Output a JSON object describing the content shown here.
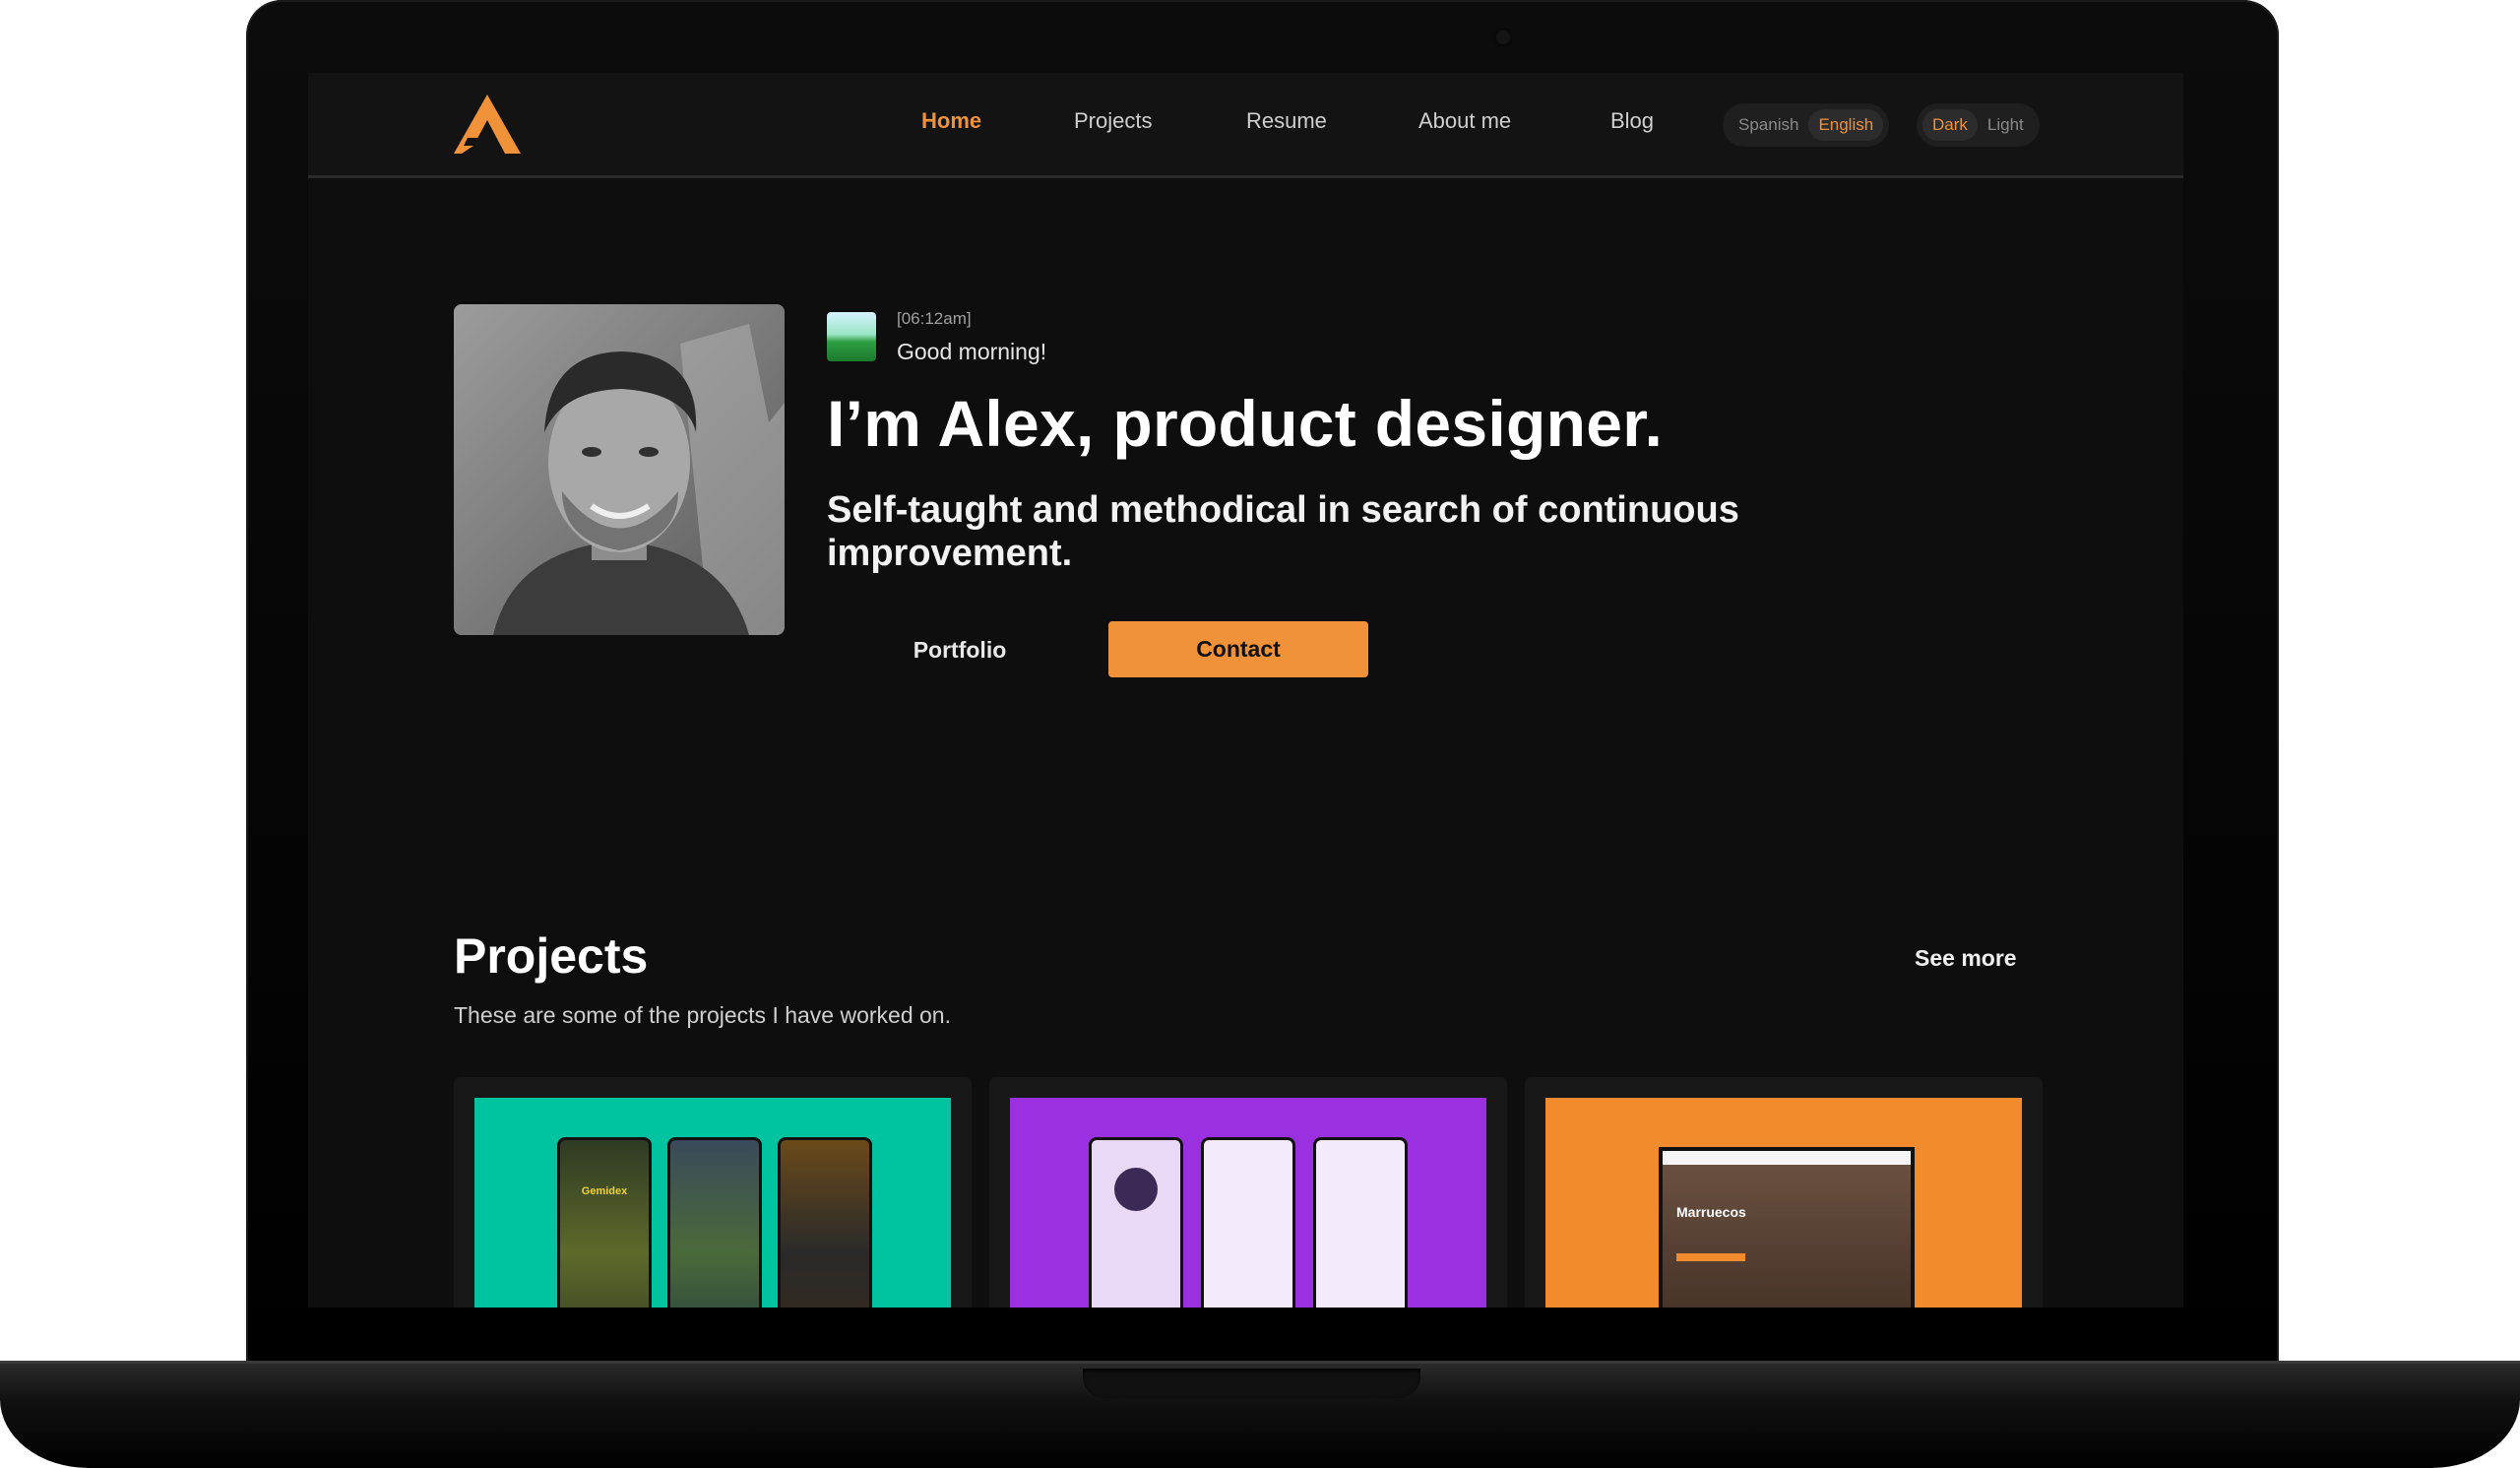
{
  "nav": {
    "links": [
      "Home",
      "Projects",
      "Resume",
      "About me",
      "Blog"
    ],
    "active": "Home",
    "language": {
      "options": [
        "Spanish",
        "English"
      ],
      "selected": "English"
    },
    "theme": {
      "options": [
        "Dark",
        "Light"
      ],
      "selected": "Dark"
    }
  },
  "hero": {
    "time": "[06:12am]",
    "greeting": "Good morning!",
    "headline": "I’m Alex, product designer.",
    "subheadline": "Self-taught and methodical in search of continuous improvement.",
    "portfolio_label": "Portfolio",
    "contact_label": "Contact"
  },
  "projects": {
    "title": "Projects",
    "subtitle": "These are some of the projects I have worked on.",
    "see_more": "See more",
    "cards": [
      {
        "color": "#00c4a0",
        "app_name": "Gemidex"
      },
      {
        "color": "#9b30e0"
      },
      {
        "color": "#f28a2e",
        "site_name": "Marruecos"
      }
    ]
  },
  "colors": {
    "accent": "#f0923a",
    "background": "#0e0e0e",
    "navbar": "#131313"
  }
}
